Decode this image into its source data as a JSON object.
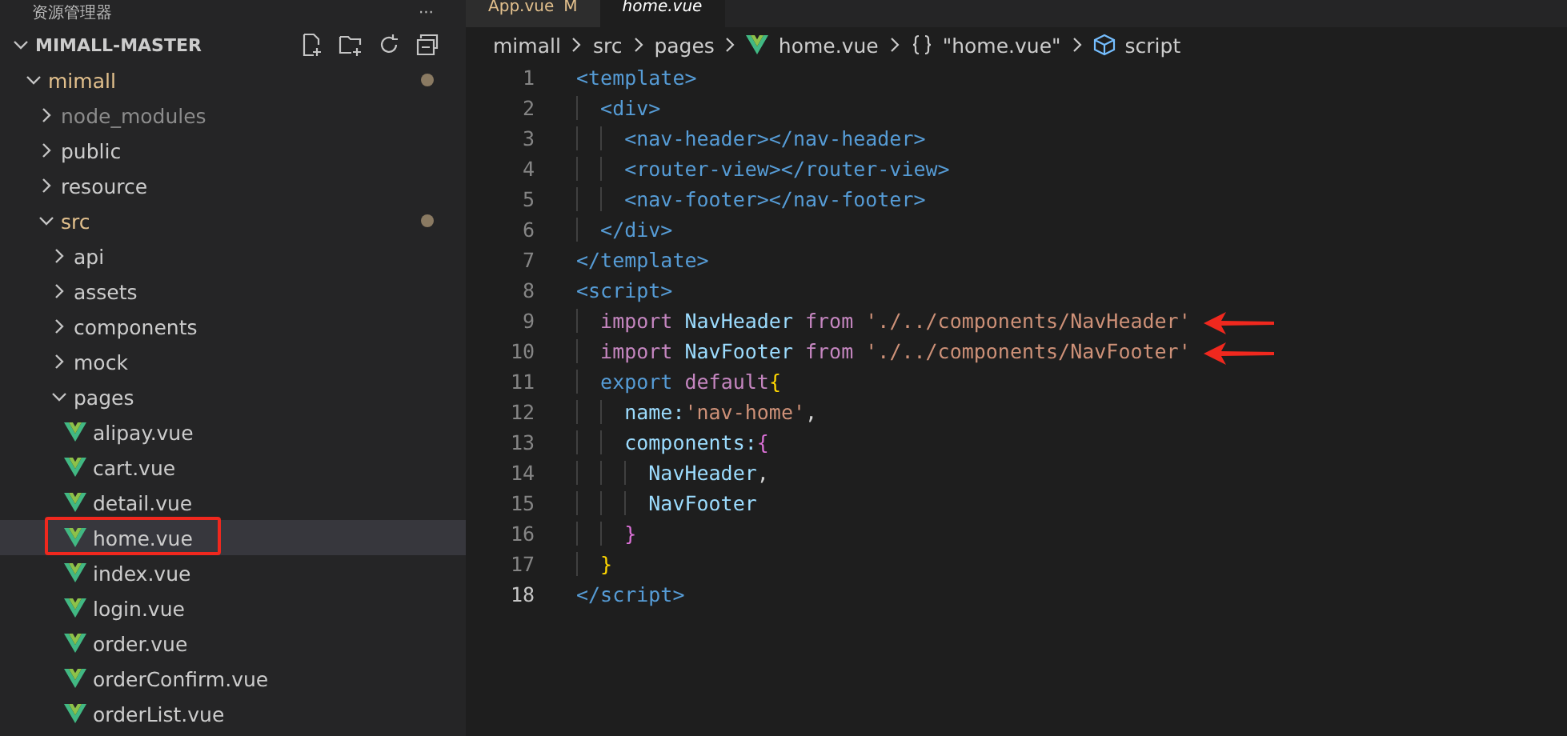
{
  "sidebar": {
    "title": "资源管理器",
    "more": "···",
    "root": {
      "label": "MIMALL-MASTER",
      "expanded": true
    },
    "tree": [
      {
        "label": "mimall",
        "expanded": true,
        "modified": true,
        "ignored": false,
        "selected": false,
        "children": [
          {
            "label": "node_modules",
            "expanded": false,
            "ignored": true,
            "selected": false
          },
          {
            "label": "public",
            "expanded": false,
            "ignored": false,
            "selected": false
          },
          {
            "label": "resource",
            "expanded": false,
            "ignored": false,
            "selected": false
          },
          {
            "label": "src",
            "expanded": true,
            "modified": true,
            "ignored": false,
            "selected": false,
            "children": [
              {
                "label": "api",
                "expanded": false,
                "ignored": false,
                "selected": false
              },
              {
                "label": "assets",
                "expanded": false,
                "ignored": false,
                "selected": false
              },
              {
                "label": "components",
                "expanded": false,
                "ignored": false,
                "selected": false
              },
              {
                "label": "mock",
                "expanded": false,
                "ignored": false,
                "selected": false
              },
              {
                "label": "pages",
                "expanded": true,
                "ignored": false,
                "selected": false,
                "children": [
                  {
                    "label": "alipay.vue",
                    "kind": "vue",
                    "selected": false
                  },
                  {
                    "label": "cart.vue",
                    "kind": "vue",
                    "selected": false
                  },
                  {
                    "label": "detail.vue",
                    "kind": "vue",
                    "selected": false
                  },
                  {
                    "label": "home.vue",
                    "kind": "vue",
                    "selected": true,
                    "annotated": true
                  },
                  {
                    "label": "index.vue",
                    "kind": "vue",
                    "selected": false
                  },
                  {
                    "label": "login.vue",
                    "kind": "vue",
                    "selected": false
                  },
                  {
                    "label": "order.vue",
                    "kind": "vue",
                    "selected": false
                  },
                  {
                    "label": "orderConfirm.vue",
                    "kind": "vue",
                    "selected": false
                  },
                  {
                    "label": "orderList.vue",
                    "kind": "vue",
                    "selected": false
                  }
                ]
              }
            ]
          }
        ]
      }
    ]
  },
  "tabs": [
    {
      "label": "App.vue",
      "badge": "M",
      "selected": false
    },
    {
      "label": "home.vue",
      "selected": true
    }
  ],
  "breadcrumbs": [
    {
      "label": "mimall",
      "kind": "folder"
    },
    {
      "label": "src",
      "kind": "folder"
    },
    {
      "label": "pages",
      "kind": "folder"
    },
    {
      "label": "home.vue",
      "kind": "vue"
    },
    {
      "label": "\"home.vue\"",
      "kind": "object"
    },
    {
      "label": "script",
      "kind": "symbol"
    }
  ],
  "code": [
    {
      "number": "1",
      "current": false,
      "tokens": [
        {
          "kind": "tag",
          "text": "<template>"
        }
      ]
    },
    {
      "number": "2",
      "current": false,
      "tokens": [
        {
          "kind": "tag",
          "text": "  <div>"
        }
      ]
    },
    {
      "number": "3",
      "current": false,
      "tokens": [
        {
          "kind": "tag",
          "text": "    <nav-header></nav-header>"
        }
      ]
    },
    {
      "number": "4",
      "current": false,
      "tokens": [
        {
          "kind": "tag",
          "text": "    <router-view></router-view>"
        }
      ]
    },
    {
      "number": "5",
      "current": false,
      "tokens": [
        {
          "kind": "tag",
          "text": "    <nav-footer></nav-footer>"
        }
      ]
    },
    {
      "number": "6",
      "current": false,
      "tokens": [
        {
          "kind": "tag",
          "text": "  </div>"
        }
      ]
    },
    {
      "number": "7",
      "current": false,
      "tokens": [
        {
          "kind": "tag",
          "text": "</template>"
        }
      ]
    },
    {
      "number": "8",
      "current": false,
      "tokens": [
        {
          "kind": "tag",
          "text": "<script>"
        }
      ]
    },
    {
      "number": "9",
      "current": false,
      "arrow": true,
      "tokens": [
        {
          "kind": "control",
          "text": "  import"
        },
        {
          "kind": "name",
          "text": " NavHeader"
        },
        {
          "kind": "control",
          "text": " from"
        },
        {
          "kind": "string",
          "text": " './../components/NavHeader'"
        }
      ]
    },
    {
      "number": "10",
      "current": false,
      "arrow": true,
      "tokens": [
        {
          "kind": "control",
          "text": "  import"
        },
        {
          "kind": "name",
          "text": " NavFooter"
        },
        {
          "kind": "control",
          "text": " from"
        },
        {
          "kind": "string",
          "text": " './../components/NavFooter'"
        }
      ]
    },
    {
      "number": "11",
      "current": false,
      "tokens": [
        {
          "kind": "keyword",
          "text": "  export"
        },
        {
          "kind": "control",
          "text": " default"
        },
        {
          "kind": "brace1",
          "text": "{"
        }
      ]
    },
    {
      "number": "12",
      "current": false,
      "tokens": [
        {
          "kind": "name",
          "text": "    name:"
        },
        {
          "kind": "string",
          "text": "'nav-home'"
        },
        {
          "kind": "plain",
          "text": ","
        }
      ]
    },
    {
      "number": "13",
      "current": false,
      "tokens": [
        {
          "kind": "name",
          "text": "    components:"
        },
        {
          "kind": "brace2",
          "text": "{"
        }
      ]
    },
    {
      "number": "14",
      "current": false,
      "tokens": [
        {
          "kind": "name",
          "text": "      NavHeader"
        },
        {
          "kind": "plain",
          "text": ","
        }
      ]
    },
    {
      "number": "15",
      "current": false,
      "tokens": [
        {
          "kind": "name",
          "text": "      NavFooter"
        }
      ]
    },
    {
      "number": "16",
      "current": false,
      "tokens": [
        {
          "kind": "brace2",
          "text": "    }"
        }
      ]
    },
    {
      "number": "17",
      "current": false,
      "tokens": [
        {
          "kind": "brace1",
          "text": "  }"
        }
      ]
    },
    {
      "number": "18",
      "current": true,
      "tokens": [
        {
          "kind": "tag",
          "text": "</script>"
        }
      ]
    }
  ]
}
